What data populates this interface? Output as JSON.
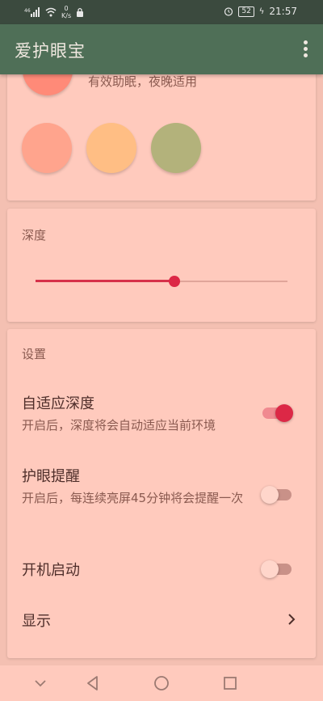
{
  "status_bar": {
    "signal": "⁴⁶ıll",
    "net_speed": "0\nK/s",
    "time": "21:57",
    "battery": "52"
  },
  "app_bar": {
    "title": "爱护眼宝",
    "menu_icon": "more-vert-icon"
  },
  "mode_card": {
    "top_mode_desc": "有效助眠，夜晚适用",
    "swatches": [
      "#ff8a78",
      "#ffa48d",
      "#ffbe84",
      "#b3b27b"
    ]
  },
  "depth_card": {
    "title": "深度",
    "slider_value": 0.55
  },
  "settings_card": {
    "title": "设置",
    "adaptive": {
      "title": "自适应深度",
      "desc": "开启后，深度将会自动适应当前环境",
      "enabled": true
    },
    "reminder": {
      "title": "护眼提醒",
      "desc": "开启后，每连续亮屏45分钟将会提醒一次",
      "enabled": false
    },
    "autostart": {
      "title": "开机启动",
      "enabled": false
    },
    "display": {
      "title": "显示"
    }
  },
  "colors": {
    "accent": "#dc2846",
    "app_bar": "#4f6f57",
    "card": "#ffcabd"
  }
}
